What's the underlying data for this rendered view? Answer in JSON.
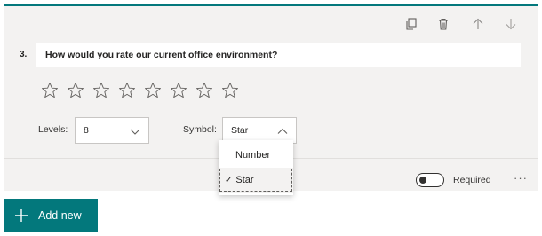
{
  "question": {
    "number": "3.",
    "text": "How would you rate our current office environment?"
  },
  "toolbar": {
    "icons": [
      "copy-icon",
      "delete-icon",
      "move-up-icon",
      "move-down-icon"
    ]
  },
  "rating": {
    "levels": 8,
    "symbol_icon": "star-outline-icon"
  },
  "settings": {
    "levels_label": "Levels:",
    "levels_value": "8",
    "symbol_label": "Symbol:",
    "symbol_value": "Star"
  },
  "symbol_dropdown": {
    "options": [
      "Number",
      "Star"
    ],
    "selected": "Star",
    "check_mark": "✓"
  },
  "footer": {
    "required_label": "Required",
    "required_on": false,
    "more_label": "···"
  },
  "add_new_label": "Add new",
  "colors": {
    "accent": "#03787c",
    "card_background": "#f3f2f1",
    "text": "#252423"
  }
}
